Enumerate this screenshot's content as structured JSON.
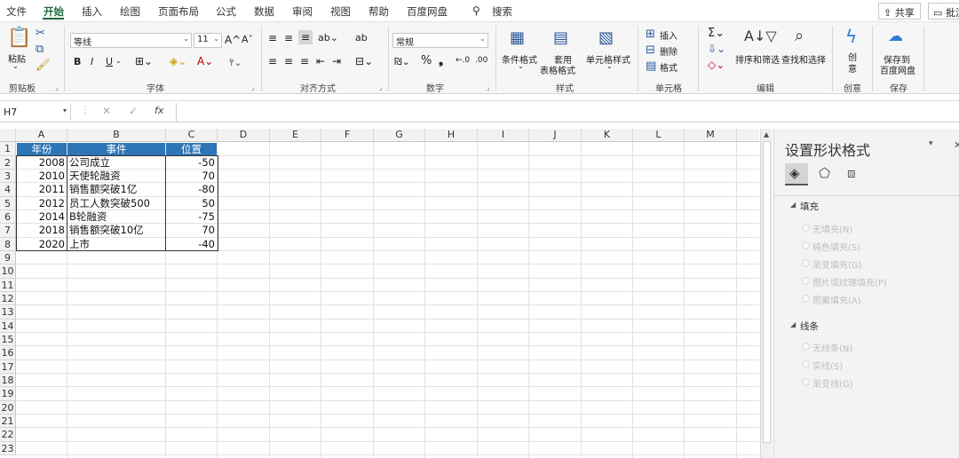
{
  "menu": {
    "items": [
      "文件",
      "开始",
      "插入",
      "绘图",
      "页面布局",
      "公式",
      "数据",
      "审阅",
      "视图",
      "帮助",
      "百度网盘"
    ],
    "active": "开始",
    "search_label": "搜索",
    "share_label": "共享",
    "comment_label": "批注"
  },
  "ribbon": {
    "clipboard": {
      "group": "剪贴板",
      "paste": "粘贴"
    },
    "font": {
      "group": "字体",
      "name": "等线",
      "size": "11",
      "bold": "B",
      "italic": "I",
      "underline": "U"
    },
    "alignment": {
      "group": "对齐方式"
    },
    "number": {
      "group": "数字",
      "format": "常规",
      "percent": "%"
    },
    "styles": {
      "group": "样式",
      "conditional": "条件格式",
      "table_format_1": "套用",
      "table_format_2": "表格格式",
      "cell_styles": "单元格样式"
    },
    "cells": {
      "group": "单元格",
      "insert": "插入",
      "delete": "删除",
      "format": "格式"
    },
    "editing": {
      "group": "编辑",
      "sort": "排序和筛选",
      "find": "查找和选择"
    },
    "ideas": {
      "group": "创意",
      "label": "创意"
    },
    "save": {
      "group": "保存",
      "label_1": "保存到",
      "label_2": "百度网盘"
    }
  },
  "formula_bar": {
    "name_box": "H7",
    "fx": "fx",
    "value": ""
  },
  "sheet": {
    "columns": [
      "A",
      "B",
      "C",
      "D",
      "E",
      "F",
      "G",
      "H",
      "I",
      "J",
      "K",
      "L",
      "M"
    ],
    "rows": [
      "1",
      "2",
      "3",
      "4",
      "5",
      "6",
      "7",
      "8",
      "9",
      "10",
      "11",
      "12",
      "13",
      "14",
      "15",
      "16",
      "17",
      "18",
      "19",
      "20",
      "21",
      "22",
      "23"
    ],
    "headers": [
      "年份",
      "事件",
      "位置"
    ],
    "data": [
      {
        "year": "2008",
        "event": "公司成立",
        "pos": "-50"
      },
      {
        "year": "2010",
        "event": "天使轮融资",
        "pos": "70"
      },
      {
        "year": "2011",
        "event": "销售额突破1亿",
        "pos": "-80"
      },
      {
        "year": "2012",
        "event": "员工人数突破500",
        "pos": "50"
      },
      {
        "year": "2014",
        "event": "B轮融资",
        "pos": "-75"
      },
      {
        "year": "2018",
        "event": "销售额突破10亿",
        "pos": "70"
      },
      {
        "year": "2020",
        "event": "上市",
        "pos": "-40"
      }
    ]
  },
  "panel": {
    "title": "设置形状格式",
    "fill_section": "填充",
    "fill_options": [
      "无填充(N)",
      "纯色填充(S)",
      "渐变填充(G)",
      "图片或纹理填充(P)",
      "图案填充(A)"
    ],
    "line_section": "线条",
    "line_options": [
      "无线条(N)",
      "实线(S)",
      "渐变线(G)"
    ]
  },
  "colors": {
    "accent": "#1e6b3c",
    "header_fill": "#2e75b6"
  }
}
